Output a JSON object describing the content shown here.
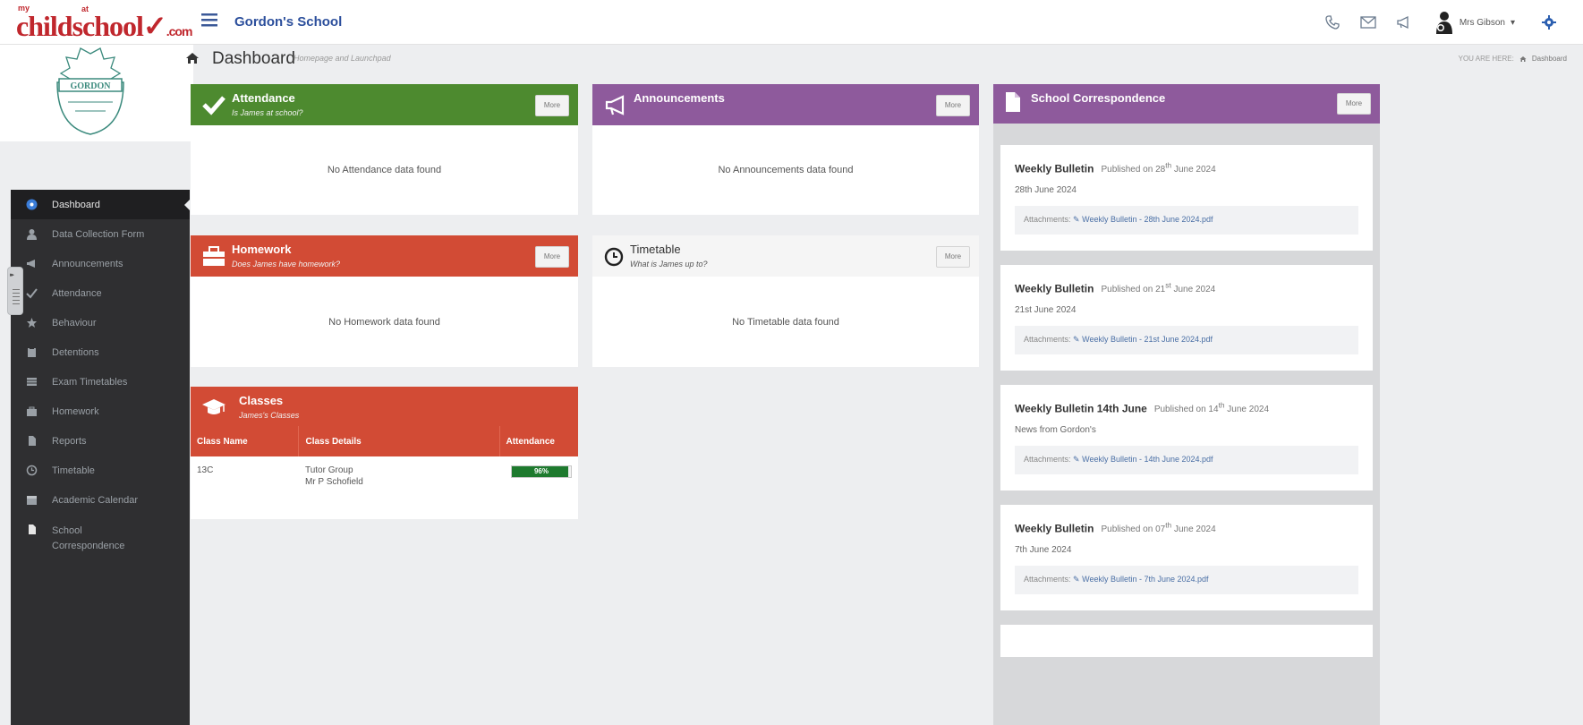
{
  "header": {
    "logo": {
      "my": "my",
      "at": "at",
      "text1": "ch",
      "text2": "ldschool",
      "com": ".com"
    },
    "school_name": "Gordon's School",
    "user_name": "Mrs Gibson",
    "user_caret": "▾"
  },
  "crest": {
    "text": "GORDON"
  },
  "page": {
    "title": "Dashboard",
    "subtitle": "Homepage and Launchpad",
    "breadcrumb_label": "YOU ARE HERE:",
    "breadcrumb_item": "Dashboard"
  },
  "sidebar": {
    "items": [
      {
        "label": "Dashboard",
        "icon": "dashboard-icon"
      },
      {
        "label": "Data Collection Form",
        "icon": "user-icon"
      },
      {
        "label": "Announcements",
        "icon": "megaphone-icon"
      },
      {
        "label": "Attendance",
        "icon": "check-icon"
      },
      {
        "label": "Behaviour",
        "icon": "star-icon"
      },
      {
        "label": "Detentions",
        "icon": "clipboard-icon"
      },
      {
        "label": "Exam Timetables",
        "icon": "table-icon"
      },
      {
        "label": "Homework",
        "icon": "briefcase-icon"
      },
      {
        "label": "Reports",
        "icon": "file-icon"
      },
      {
        "label": "Timetable",
        "icon": "clock-icon"
      },
      {
        "label": "Academic Calendar",
        "icon": "calendar-icon"
      },
      {
        "label": "School Correspondence",
        "icon": "document-icon"
      }
    ]
  },
  "panels": {
    "attendance": {
      "title": "Attendance",
      "subtitle": "Is James at school?",
      "more": "More",
      "empty": "No Attendance data found"
    },
    "announcements": {
      "title": "Announcements",
      "more": "More",
      "empty": "No Announcements data found"
    },
    "homework": {
      "title": "Homework",
      "subtitle": "Does James have homework?",
      "more": "More",
      "empty": "No Homework data found"
    },
    "timetable": {
      "title": "Timetable",
      "subtitle": "What is James up to?",
      "more": "More",
      "empty": "No Timetable data found"
    },
    "classes": {
      "title": "Classes",
      "subtitle": "James's Classes",
      "columns": [
        "Class Name",
        "Class Details",
        "Attendance"
      ],
      "rows": [
        {
          "name": "13C",
          "details1": "Tutor Group",
          "details2": "Mr P Schofield",
          "attendance_label": "96%",
          "attendance_value": 96
        }
      ]
    }
  },
  "correspondence": {
    "title": "School Correspondence",
    "more": "More",
    "attachments_label": "Attachments:",
    "items": [
      {
        "title": "Weekly Bulletin",
        "published_prefix": "Published on 28",
        "published_sup": "th",
        "published_suffix": "June 2024",
        "desc": "28th June 2024",
        "attachment": "Weekly Bulletin - 28th June 2024.pdf"
      },
      {
        "title": "Weekly Bulletin",
        "published_prefix": "Published on 21",
        "published_sup": "st",
        "published_suffix": "June 2024",
        "desc": "21st June 2024",
        "attachment": "Weekly Bulletin - 21st June 2024.pdf"
      },
      {
        "title": "Weekly Bulletin 14th June",
        "published_prefix": "Published on 14",
        "published_sup": "th",
        "published_suffix": "June 2024",
        "desc": "News from Gordon's",
        "attachment": "Weekly Bulletin - 14th June 2024.pdf"
      },
      {
        "title": "Weekly Bulletin",
        "published_prefix": "Published on 07",
        "published_sup": "th",
        "published_suffix": "June 2024",
        "desc": "7th June 2024",
        "attachment": "Weekly Bulletin - 7th June 2024.pdf"
      }
    ]
  },
  "colors": {
    "attendance": "#4d8a2f",
    "announcements": "#8e5a9c",
    "homework": "#d24b35",
    "classes": "#d24b35",
    "correspondence": "#8e5a9c",
    "sidebar": "#2f2f31",
    "brand": "#c0272d",
    "link": "#2c4f9c"
  }
}
